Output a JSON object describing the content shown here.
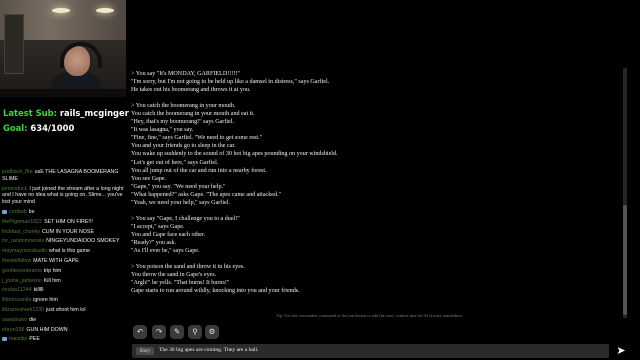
{
  "stream": {
    "latest_sub_label": "Latest Sub:",
    "latest_sub_name": "rails_mcginger",
    "goal_label": "Goal:",
    "goal_value": "634/1000"
  },
  "chat": [
    {
      "nick": "pudbach_flre",
      "text": "usE THE LASAGNA BOOMERANG SLIME",
      "badge": false
    },
    {
      "nick": "jamesduck",
      "text": "I just joined the stream after a long night and I have no idea what is going on. Slime... you've lost your mind",
      "badge": false
    },
    {
      "nick": "crotbob",
      "text": "be",
      "badge": true
    },
    {
      "nick": "thePigeman1022",
      "text": "SET HIM ON FIRE!!!",
      "badge": false
    },
    {
      "nick": "frickfast_chonky",
      "text": "CUM IN YOUR NOSE",
      "badge": false
    },
    {
      "nick": "mr_randomnessis",
      "text": "NINGEYUNDAIOOO SMOKEY",
      "badge": false
    },
    {
      "nick": "maymaymorabadin",
      "text": "what is this game",
      "badge": false
    },
    {
      "nick": "thelatelbllow",
      "text": "MATE WITH GAPE",
      "badge": false
    },
    {
      "nick": "gordlarvontearns",
      "text": "trip him",
      "badge": false
    },
    {
      "nick": "j_joshe_jameson",
      "text": "Kill him",
      "badge": false
    },
    {
      "nick": "ncolas11244",
      "text": "killlll",
      "badge": false
    },
    {
      "nick": "lilbrotuxsnila",
      "text": "ignore him",
      "badge": false
    },
    {
      "nick": "ibizarreshark1230",
      "text": "just shoot him lol",
      "badge": false
    },
    {
      "nick": "sawainuko",
      "text": "die",
      "badge": false
    },
    {
      "nick": "ebrun336",
      "text": "GUN HIM DOWN",
      "badge": false
    },
    {
      "nick": "naoziko",
      "text": "PEE",
      "badge": true
    }
  ],
  "story": [
    "> You say \"It's MONDAY, GARFIELD!!!!!\"",
    "\"I'm sorry, but I'm not going to be held up like a damsel in distress,\" says Garfiel.",
    "He takes out his boomerang and throws it at you.",
    "",
    "> You catch the boomerang in your mouth.",
    "You catch the boomerang in your mouth and eat it.",
    "\"Hey, that's my boomerang!\" says Garfiel.",
    "\"It was lasagna,\" you say.",
    "\"Fine, fine,\" says Garfiel. \"We need to get some rest.\"",
    "You and your friends go to sleep in the car.",
    "You wake up suddenly to the sound of 30 hot big apes pounding on your windshield.",
    "\"Let's get out of here,\" says Garfiel.",
    "You all jump out of the car and run into a nearby forest.",
    "You see Gape.",
    "\"Gape,\" you say. \"We need your help.\"",
    "\"What happened?\" asks Gape. \"The apes came and attacked.\"",
    "\"Yeah, we need your help,\" says Garfiel.",
    "",
    "> You say \"Gape, I challenge you to a duel!\"",
    "\"I accept,\" says Gape.",
    "You and Gape face each other.",
    "\"Ready?\" you ask.",
    "\"As I'll ever be,\" says Gape.",
    "",
    "> You poison the sand and throw it in his eyes.",
    "You throw the sand in Gape's eyes.",
    "\"Argh!\" he yells. \"That burns! It burns!\"",
    "Gape starts to run around wildly, knocking into you and your friends."
  ],
  "tip": "Tip: Use the /remember command or the pin button to add the story context that the AI always remembers.",
  "toolbar": {
    "undo_glyph": "↶",
    "redo_glyph": "↷",
    "edit_glyph": "✎",
    "pin_glyph": "⚲",
    "settings_glyph": "⚙"
  },
  "input": {
    "mode_label": "Story",
    "text": "The 30 big apes are coming. They are a ball."
  },
  "send_glyph": "➤",
  "colors": {
    "accent_green": "#3fd23a",
    "chat_nick": "#4e7d3c",
    "background": "#000000",
    "panel": "#2b2b2b"
  }
}
